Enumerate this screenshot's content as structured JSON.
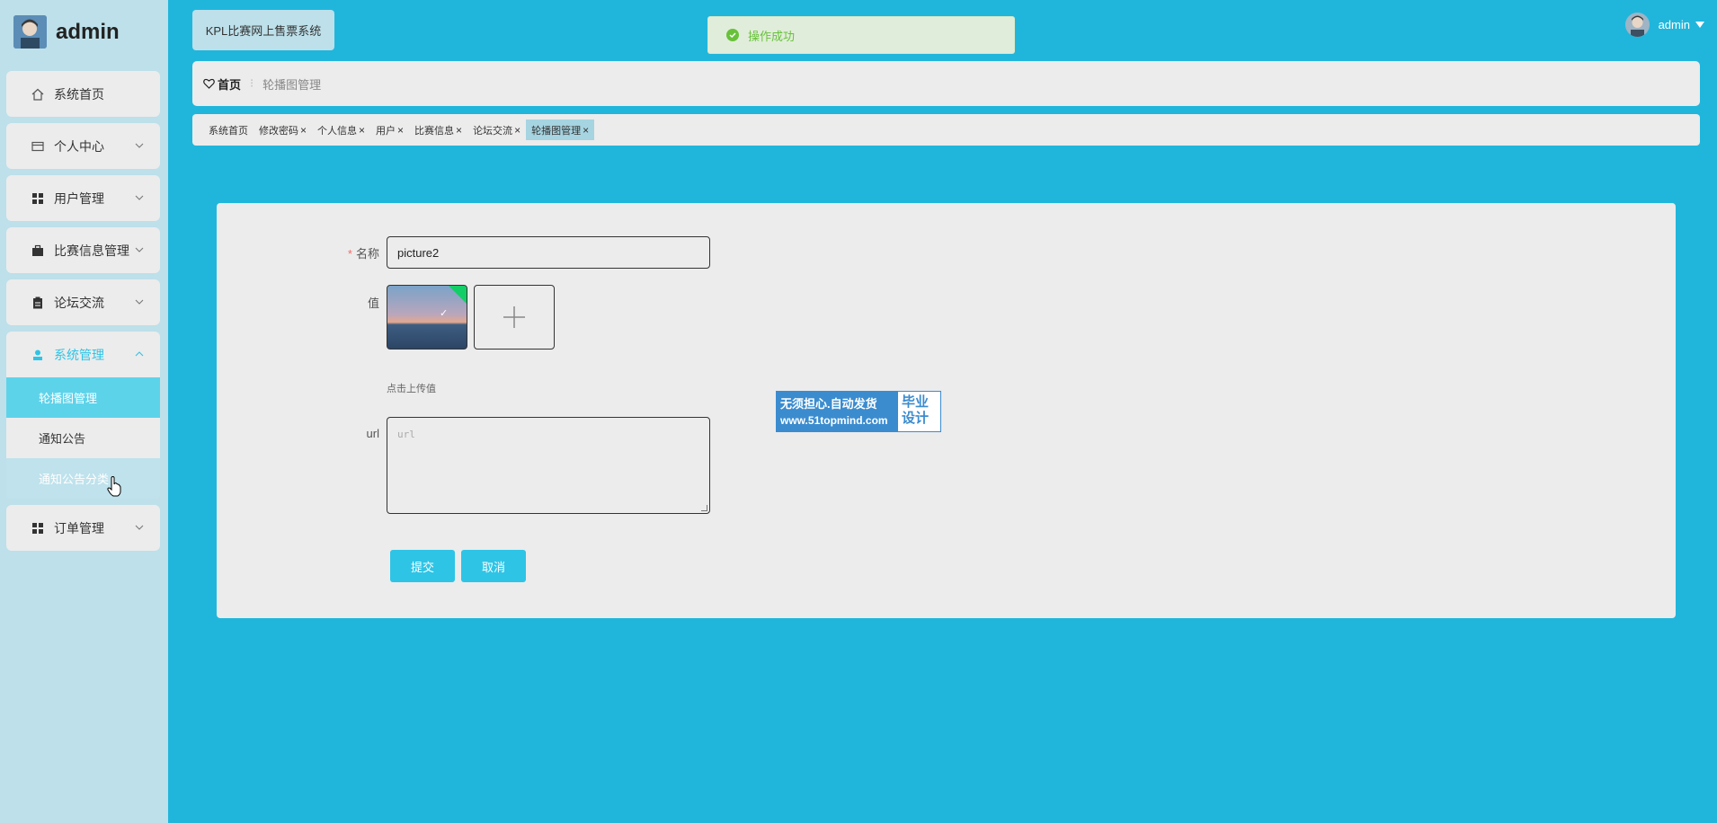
{
  "sidebar": {
    "brand": "admin",
    "items": [
      {
        "label": "系统首页",
        "icon": "home-icon",
        "has_submenu": false
      },
      {
        "label": "个人中心",
        "icon": "wallet-icon",
        "has_submenu": true
      },
      {
        "label": "用户管理",
        "icon": "grid-icon",
        "has_submenu": true
      },
      {
        "label": "比赛信息管理",
        "icon": "briefcase-icon",
        "has_submenu": true
      },
      {
        "label": "论坛交流",
        "icon": "clipboard-icon",
        "has_submenu": true
      },
      {
        "label": "系统管理",
        "icon": "user-icon",
        "has_submenu": true,
        "open": true
      },
      {
        "label": "订单管理",
        "icon": "grid-icon",
        "has_submenu": true
      }
    ],
    "submenu": [
      {
        "label": "轮播图管理",
        "state": "active"
      },
      {
        "label": "通知公告",
        "state": "normal"
      },
      {
        "label": "通知公告分类",
        "state": "hover"
      }
    ]
  },
  "header": {
    "system_name": "KPL比赛网上售票系统",
    "toast": "操作成功",
    "username": "admin"
  },
  "breadcrumb": {
    "home": "首页",
    "current": "轮播图管理"
  },
  "tabs": [
    {
      "label": "系统首页",
      "closable": false,
      "active": false
    },
    {
      "label": "修改密码",
      "closable": true,
      "active": false
    },
    {
      "label": "个人信息",
      "closable": true,
      "active": false
    },
    {
      "label": "用户",
      "closable": true,
      "active": false
    },
    {
      "label": "比赛信息",
      "closable": true,
      "active": false
    },
    {
      "label": "论坛交流",
      "closable": true,
      "active": false
    },
    {
      "label": "轮播图管理",
      "closable": true,
      "active": true
    }
  ],
  "form": {
    "name_label": "名称",
    "name_value": "picture2",
    "value_label": "值",
    "upload_hint": "点击上传值",
    "url_label": "url",
    "url_placeholder": "url",
    "submit_label": "提交",
    "cancel_label": "取消"
  },
  "watermark": {
    "line1": "无须担心.自动发货",
    "line2": "www.51topmind.com",
    "side": "毕业设计"
  },
  "colors": {
    "background": "#20b6dc",
    "accent": "#2ec4e6",
    "success": "#67c23a",
    "required": "#f56c6c"
  }
}
